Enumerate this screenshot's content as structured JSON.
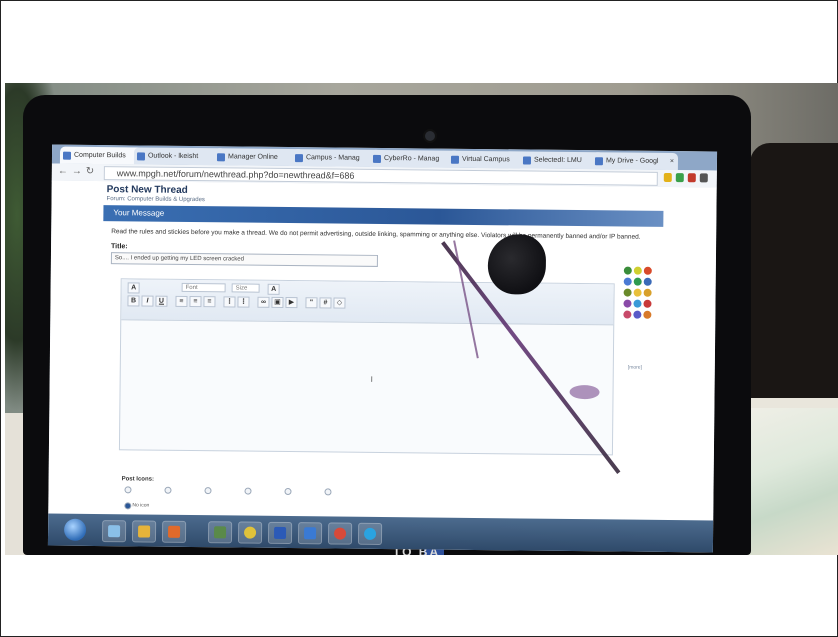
{
  "browser": {
    "tabs": [
      {
        "label": "Computer Builds"
      },
      {
        "label": "Outlook - lkeisht"
      },
      {
        "label": "Manager Online"
      },
      {
        "label": "Campus - Manag"
      },
      {
        "label": "CyberRo - Manag"
      },
      {
        "label": "Virtual Campus"
      },
      {
        "label": "SelectedI: LMU"
      },
      {
        "label": "My Drive - Googl"
      }
    ],
    "url": "www.mpgh.net/forum/newthread.php?do=newthread&f=686"
  },
  "forum": {
    "page_title": "Post New Thread",
    "breadcrumb": "Forum: Computer Builds & Upgrades",
    "message_header": "Your Message",
    "rules_text": "Read the rules and stickies before you make a thread. We do not permit advertising, outside linking, spamming or anything else. Violators will be permanently banned and/or IP banned.",
    "title_label": "Title:",
    "title_value": "So.... I ended up getting my LED screen cracked",
    "font_select": "Font",
    "size_select": "Size",
    "bold": "B",
    "italic": "I",
    "underline": "U",
    "more_link": "[more]",
    "post_icons_label": "Post Icons:",
    "no_icon": "No icon"
  },
  "laptop": {
    "brand": "TO  BA"
  },
  "colors": {
    "accent": "#2b5797",
    "taskbar": "#2f4a6a",
    "crack": "#5b2b6e"
  }
}
